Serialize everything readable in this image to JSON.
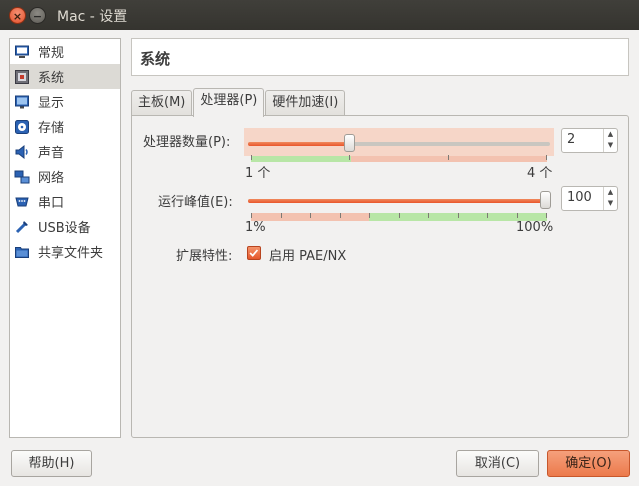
{
  "window": {
    "title": "Mac - 设置"
  },
  "sidebar": {
    "items": [
      {
        "label": "常规",
        "icon": "monitor-icon"
      },
      {
        "label": "系统",
        "icon": "system-board-icon"
      },
      {
        "label": "显示",
        "icon": "display-icon"
      },
      {
        "label": "存储",
        "icon": "storage-icon"
      },
      {
        "label": "声音",
        "icon": "speaker-icon"
      },
      {
        "label": "网络",
        "icon": "network-icon"
      },
      {
        "label": "串口",
        "icon": "serial-port-icon"
      },
      {
        "label": "USB设备",
        "icon": "usb-icon"
      },
      {
        "label": "共享文件夹",
        "icon": "folder-icon"
      }
    ],
    "selected_index": 1
  },
  "header": {
    "title": "系统"
  },
  "tabs": [
    {
      "label": "主板(M)"
    },
    {
      "label": "处理器(P)"
    },
    {
      "label": "硬件加速(I)"
    }
  ],
  "active_tab": 1,
  "processor": {
    "cpu_count": {
      "label": "处理器数量(P):",
      "value": "2",
      "min_label": "1 个",
      "max_label": "4 个",
      "min": 1,
      "max": 4,
      "current": 2
    },
    "execution_cap": {
      "label": "运行峰值(E):",
      "value": "100",
      "min_label": "1%",
      "max_label": "100%",
      "min": 1,
      "max": 100,
      "current": 100
    },
    "extended_features": {
      "label": "扩展特性:",
      "pae_nx_label": "启用 PAE/NX",
      "pae_nx_checked": true
    }
  },
  "buttons": {
    "help": "帮助(H)",
    "cancel": "取消(C)",
    "ok": "确定(O)"
  },
  "colors": {
    "accent": "#e9552b",
    "warn_zone": "#f6d6c8",
    "ok_zone": "#b8e6a6",
    "titlebar": "#3c3b37"
  }
}
